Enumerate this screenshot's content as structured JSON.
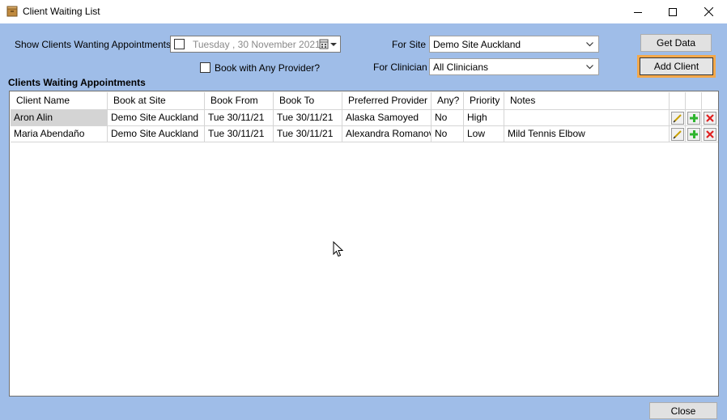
{
  "window": {
    "title": "Client Waiting List"
  },
  "filters": {
    "show_label": "Show Clients Wanting Appointments on",
    "date_day": "Tuesday",
    "date_value": ", 30 November 2021",
    "book_any_label": "Book with Any Provider?",
    "site_label": "For Site",
    "site_value": "Demo Site Auckland",
    "clinician_label": "For Clinician",
    "clinician_value": "All Clinicians"
  },
  "buttons": {
    "get_data": "Get Data",
    "add_client": "Add Client",
    "close": "Close"
  },
  "grid": {
    "title": "Clients Waiting Appointments",
    "columns": [
      "Client Name",
      "Book at Site",
      "Book From",
      "Book To",
      "Preferred Provider",
      "Any?",
      "Priority",
      "Notes"
    ],
    "rows": [
      [
        "Aron Alin",
        "Demo Site Auckland",
        "Tue 30/11/21",
        "Tue 30/11/21",
        "Alaska Samoyed",
        "No",
        "High",
        ""
      ],
      [
        "Maria Abendaño",
        "Demo Site Auckland",
        "Tue 30/11/21",
        "Tue 30/11/21",
        "Alexandra Romanova",
        "No",
        "Low",
        "Mild Tennis Elbow"
      ]
    ]
  },
  "icons": {
    "edit": "pencil-icon",
    "add": "plus-icon",
    "delete": "delete-icon"
  },
  "colors": {
    "background": "#9fbde8",
    "focus": "#f4a84a",
    "add_green": "#2fb52f",
    "delete_red": "#e02020"
  }
}
